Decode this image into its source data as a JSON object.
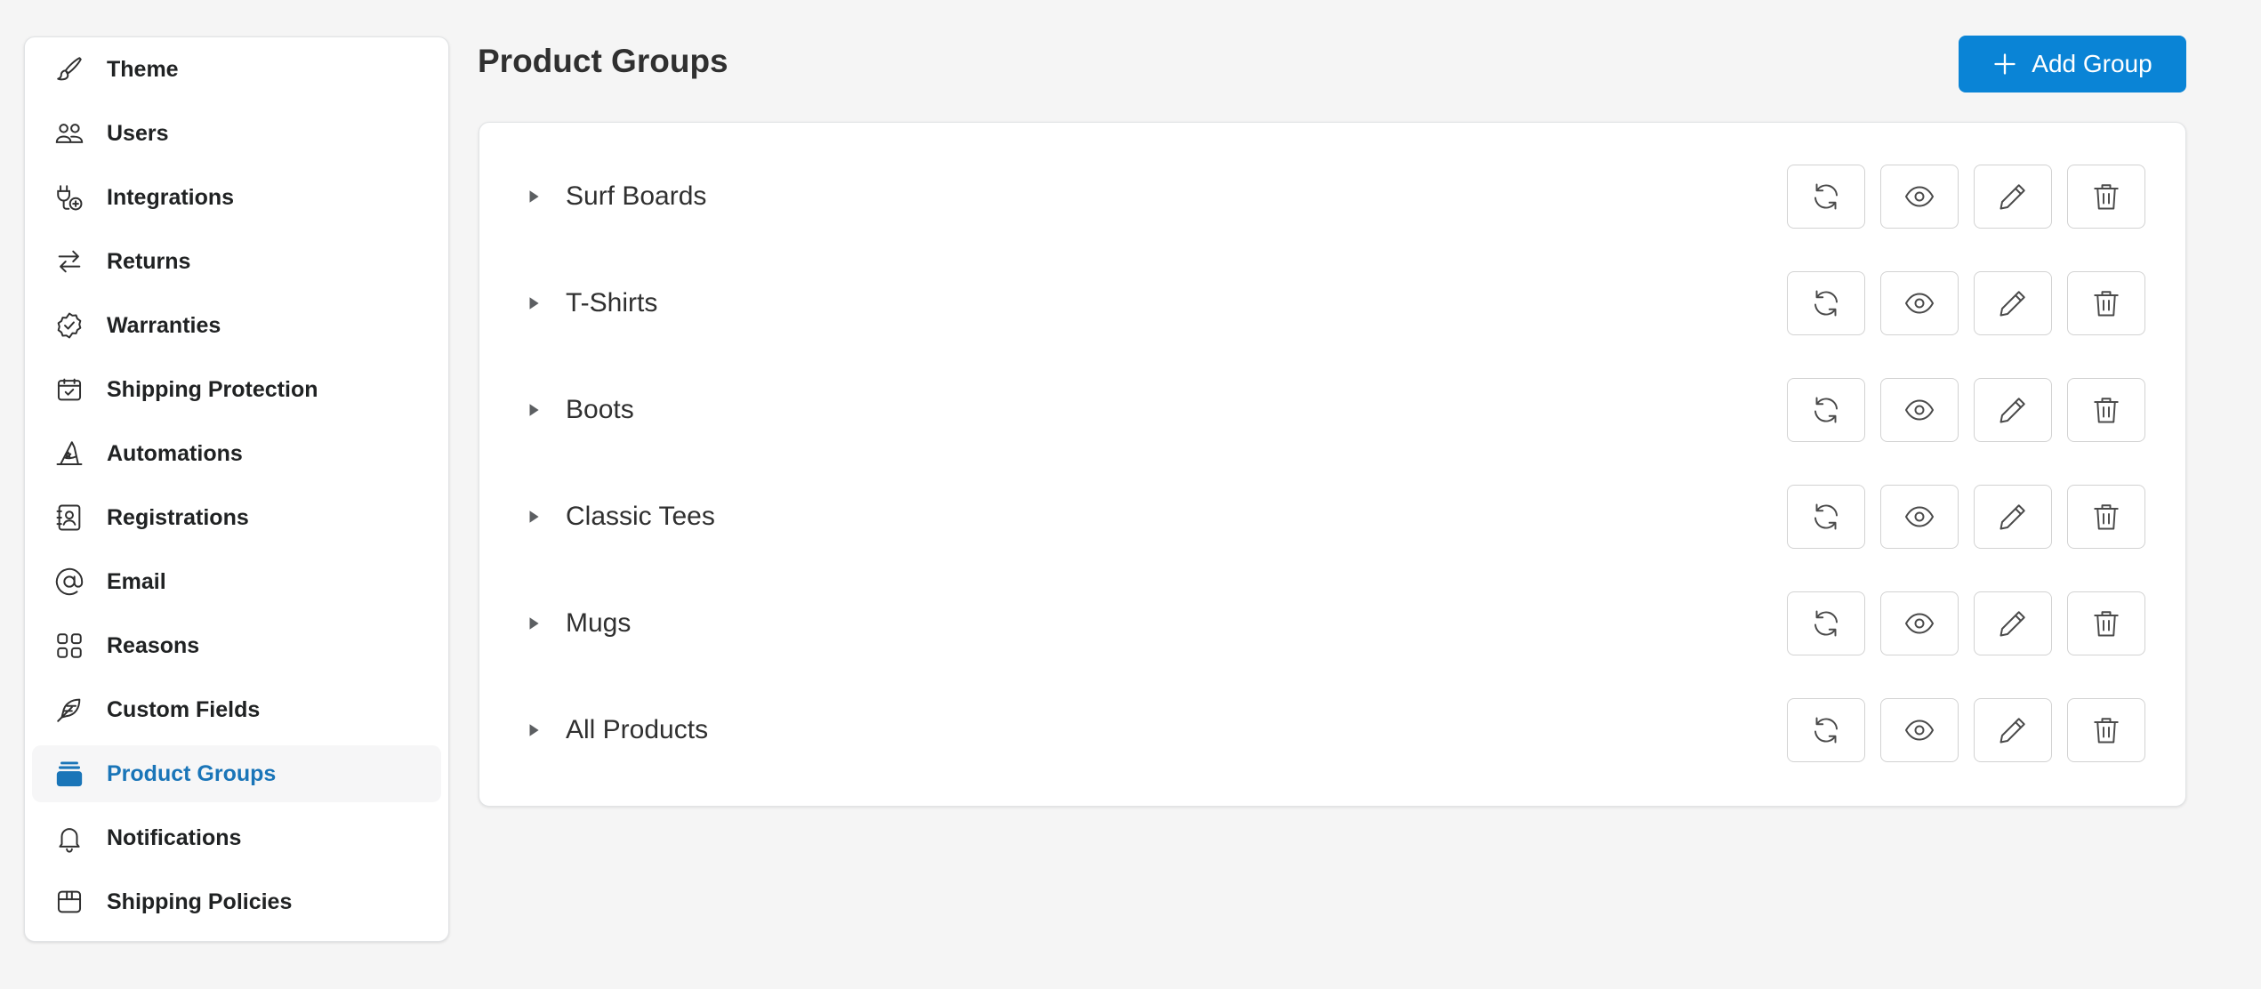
{
  "sidebar": {
    "items": [
      {
        "label": "Theme",
        "icon": "brush-icon",
        "active": false
      },
      {
        "label": "Users",
        "icon": "users-icon",
        "active": false
      },
      {
        "label": "Integrations",
        "icon": "plug-icon",
        "active": false
      },
      {
        "label": "Returns",
        "icon": "arrows-exchange-icon",
        "active": false
      },
      {
        "label": "Warranties",
        "icon": "badge-check-icon",
        "active": false
      },
      {
        "label": "Shipping Protection",
        "icon": "package-check-icon",
        "active": false
      },
      {
        "label": "Automations",
        "icon": "wizard-hat-icon",
        "active": false
      },
      {
        "label": "Registrations",
        "icon": "contact-book-icon",
        "active": false
      },
      {
        "label": "Email",
        "icon": "at-sign-icon",
        "active": false
      },
      {
        "label": "Reasons",
        "icon": "grid-icon",
        "active": false
      },
      {
        "label": "Custom Fields",
        "icon": "feather-icon",
        "active": false
      },
      {
        "label": "Product Groups",
        "icon": "stack-icon",
        "active": true
      },
      {
        "label": "Notifications",
        "icon": "bell-icon",
        "active": false
      },
      {
        "label": "Shipping Policies",
        "icon": "box-icon",
        "active": false
      }
    ]
  },
  "header": {
    "title": "Product Groups",
    "add_button_label": "Add Group"
  },
  "groups": [
    {
      "name": "Surf Boards"
    },
    {
      "name": "T-Shirts"
    },
    {
      "name": "Boots"
    },
    {
      "name": "Classic Tees"
    },
    {
      "name": "Mugs"
    },
    {
      "name": "All Products"
    }
  ],
  "row_actions": [
    "refresh-icon",
    "eye-icon",
    "pencil-icon",
    "trash-icon"
  ],
  "colors": {
    "accent": "#0a84d6",
    "active_nav_text": "#1a75b8",
    "background": "#f5f5f5"
  }
}
